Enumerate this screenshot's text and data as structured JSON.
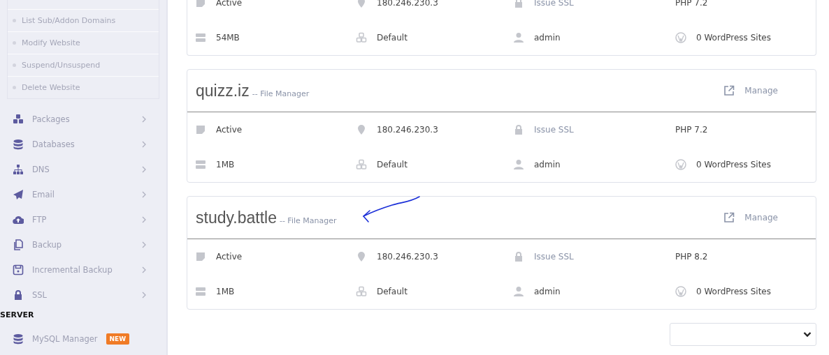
{
  "sidebar": {
    "submenu": [
      "List Sub/Addon Domains",
      "Modify Website",
      "Suspend/Unsuspend",
      "Delete Website"
    ],
    "menu": [
      {
        "label": "Packages"
      },
      {
        "label": "Databases"
      },
      {
        "label": "DNS"
      },
      {
        "label": "Email"
      },
      {
        "label": "FTP"
      },
      {
        "label": "Backup"
      },
      {
        "label": "Incremental Backup"
      },
      {
        "label": "SSL"
      }
    ],
    "section": "SERVER",
    "section_items": [
      {
        "label": "MySQL Manager",
        "badge": "NEW"
      }
    ]
  },
  "websites": [
    {
      "status": "Active",
      "ip": "180.246.230.3",
      "ssl": "Issue SSL",
      "php": "PHP 7.2",
      "disk": "54MB",
      "package": "Default",
      "owner": "admin",
      "wordpress": "0 WordPress Sites"
    },
    {
      "domain": "quizz.iz",
      "file_manager": "-- File Manager",
      "manage": "Manage",
      "status": "Active",
      "ip": "180.246.230.3",
      "ssl": "Issue SSL",
      "php": "PHP 7.2",
      "disk": "1MB",
      "package": "Default",
      "owner": "admin",
      "wordpress": "0 WordPress Sites"
    },
    {
      "domain": "study.battle",
      "file_manager": "-- File Manager",
      "manage": "Manage",
      "annotation_arrow": true,
      "status": "Active",
      "ip": "180.246.230.3",
      "ssl": "Issue SSL",
      "php": "PHP 8.2",
      "disk": "1MB",
      "package": "Default",
      "owner": "admin",
      "wordpress": "0 WordPress Sites"
    }
  ],
  "pagination_select": {
    "kind": "dropdown"
  }
}
